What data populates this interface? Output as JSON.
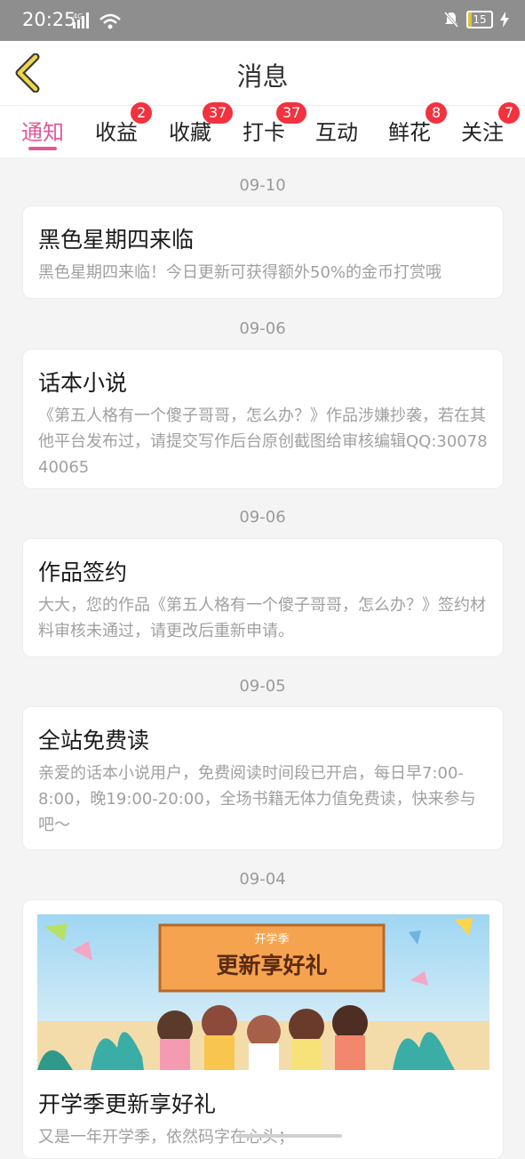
{
  "status": {
    "time": "20:25",
    "net": "4G",
    "battery": "15"
  },
  "header": {
    "title": "消息"
  },
  "tabs": [
    {
      "label": "通知",
      "badge": ""
    },
    {
      "label": "收益",
      "badge": "2"
    },
    {
      "label": "收藏",
      "badge": "37"
    },
    {
      "label": "打卡",
      "badge": "37"
    },
    {
      "label": "互动",
      "badge": ""
    },
    {
      "label": "鲜花",
      "badge": "8"
    },
    {
      "label": "关注",
      "badge": "7"
    }
  ],
  "messages": [
    {
      "date": "09-10",
      "title": "黑色星期四来临",
      "body": "黑色星期四来临！今日更新可获得额外50%的金币打赏哦"
    },
    {
      "date": "09-06",
      "title": "话本小说",
      "body": "《第五人格有一个傻子哥哥，怎么办？》作品涉嫌抄袭，若在其他平台发布过，请提交写作后台原创截图给审核编辑QQ:3007840065"
    },
    {
      "date": "09-06",
      "title": "作品签约",
      "body": "大大，您的作品《第五人格有一个傻子哥哥，怎么办？》签约材料审核未通过，请更改后重新申请。"
    },
    {
      "date": "09-05",
      "title": "全站免费读",
      "body": "亲爱的话本小说用户，免费阅读时间段已开启，每日早7:00-8:00，晚19:00-20:00，全场书籍无体力值免费读，快来参与吧～"
    },
    {
      "date": "09-04",
      "title": "开学季更新享好礼",
      "body": "又是一年开学季，依然码字在心头；",
      "banner_top": "开学季",
      "banner_main": "更新享好礼"
    }
  ],
  "colors": {
    "accent": "#e0589a",
    "badge": "#f2323f"
  }
}
